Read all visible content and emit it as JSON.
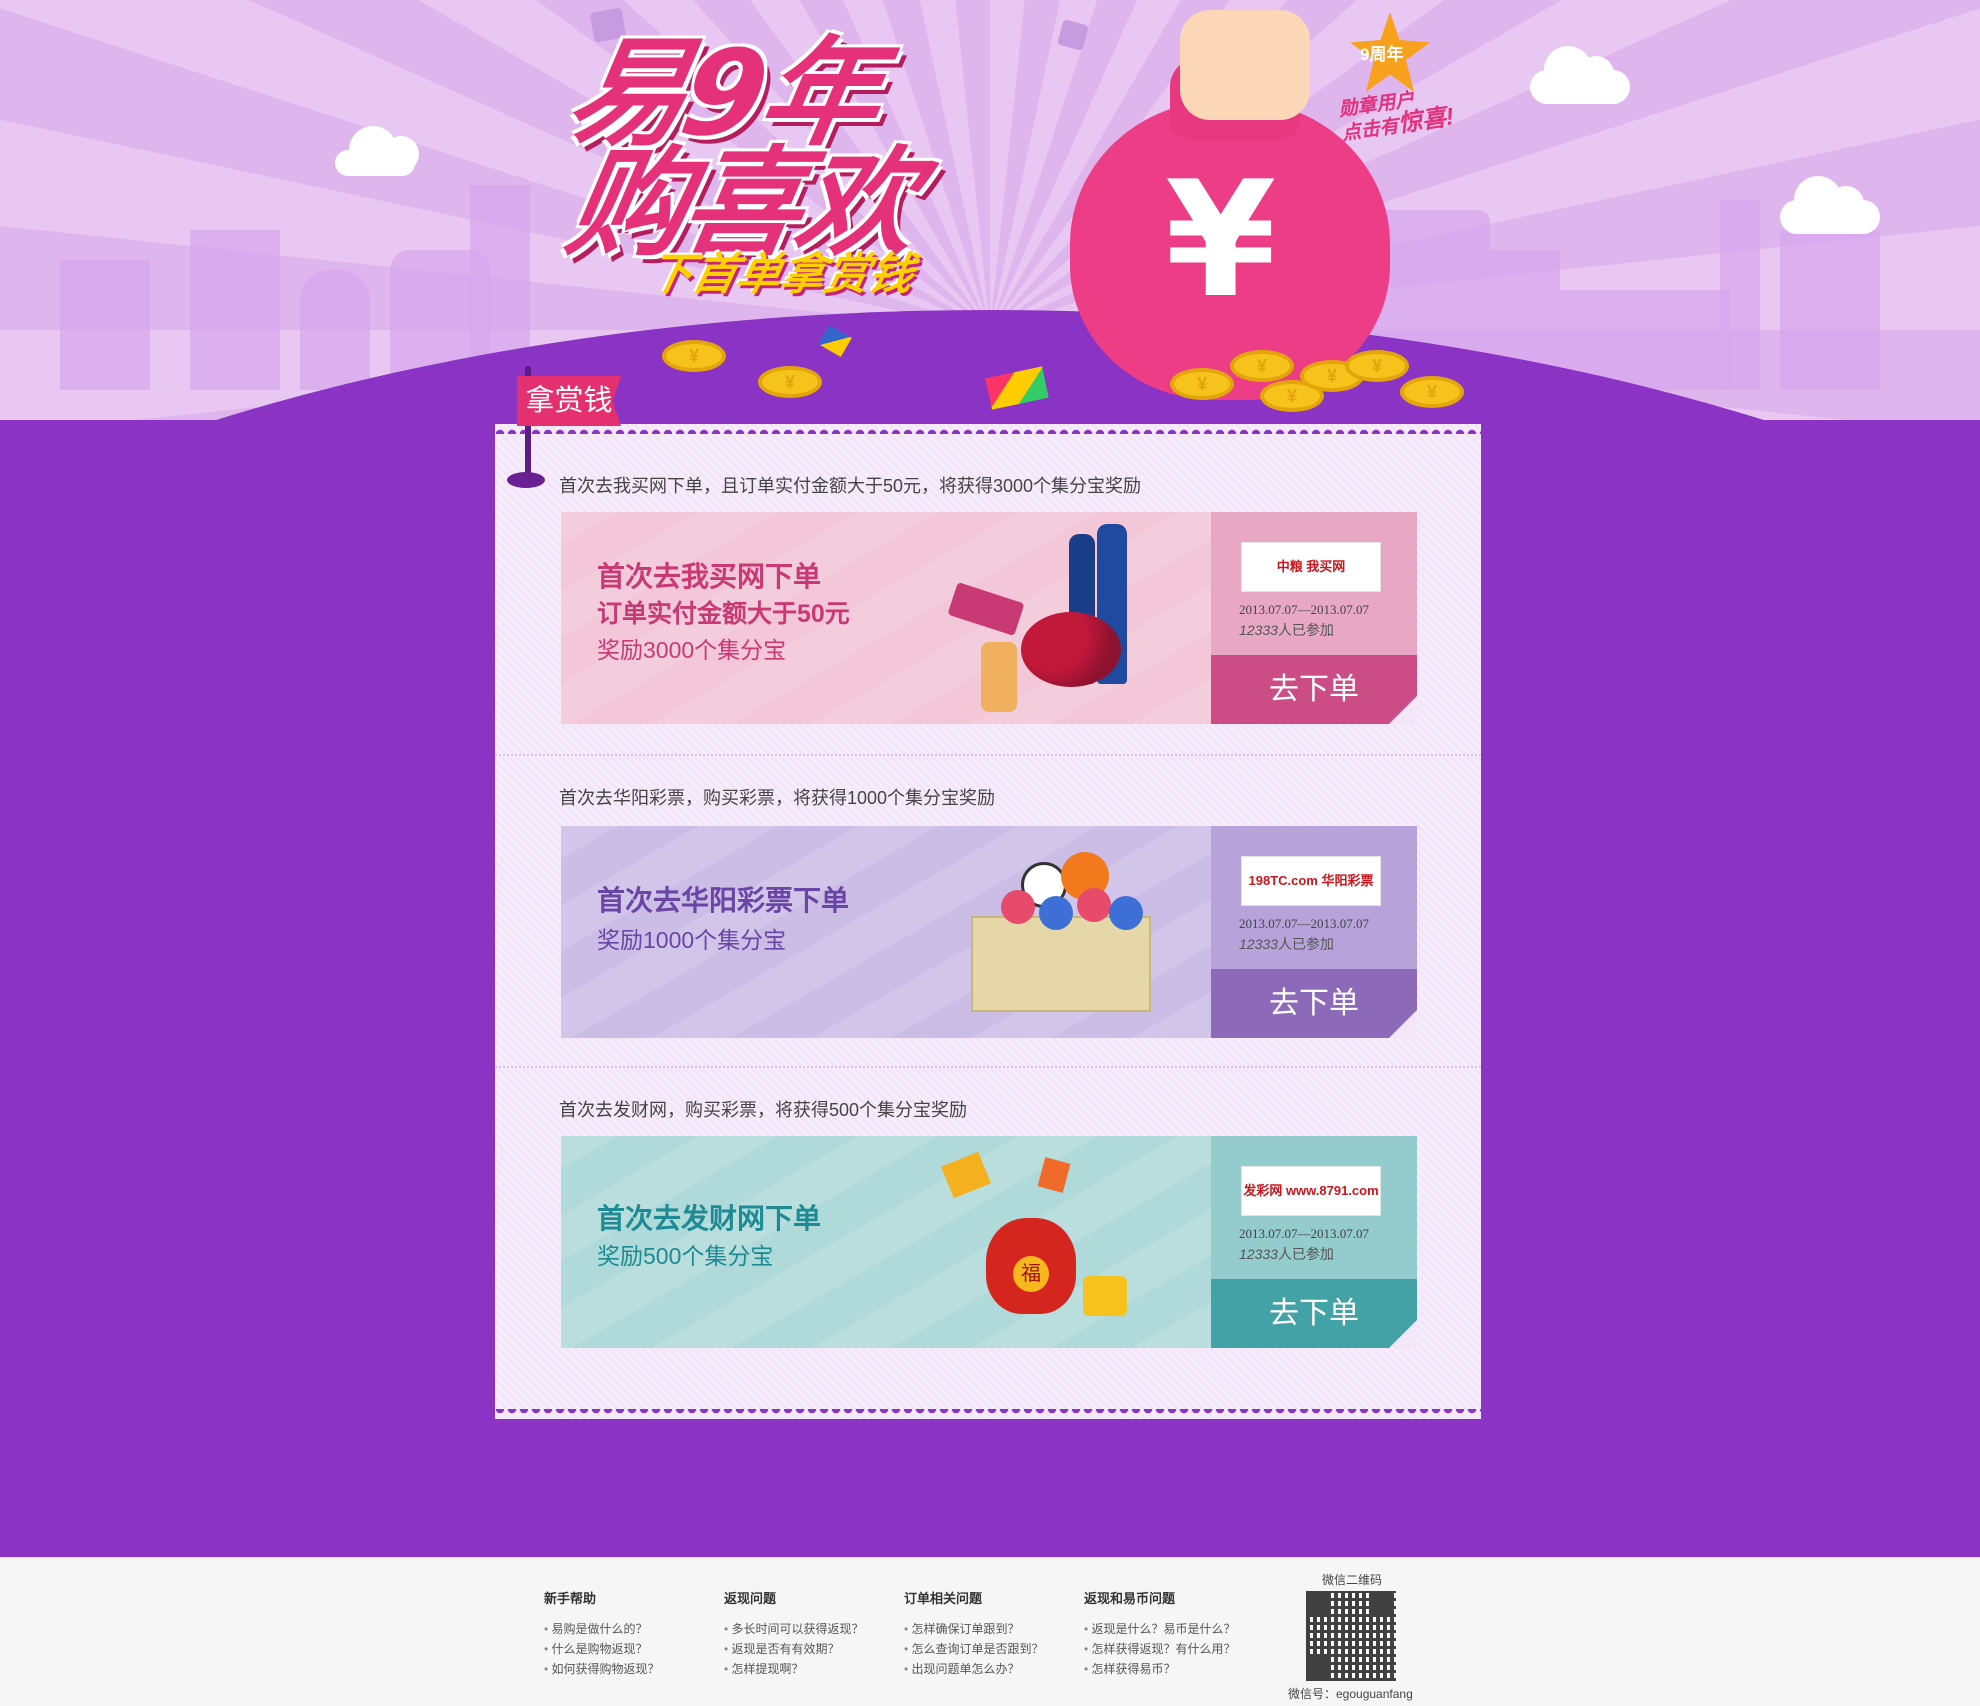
{
  "hero": {
    "title_line1": "易9年",
    "title_line2": "购喜欢",
    "subtitle": "下首单拿赏钱",
    "badge_top": "9周年",
    "badge_line1": "勋章用户",
    "badge_line2": "点击有",
    "badge_emph": "惊喜!"
  },
  "card": {
    "flag": "拿赏钱",
    "sections": [
      {
        "title": "首次去我买网下单，且订单实付金额大于50元，将获得3000个集分宝奖励",
        "heading": "首次去我买网下单",
        "line2": "订单实付金额大于50元",
        "line3": "奖励3000个集分宝",
        "logo": "中粮 我买网",
        "date": "2013.07.07—2013.07.07",
        "count": "12333",
        "count_suffix": "人已参加",
        "button": "去下单",
        "accent": "#cc4d86"
      },
      {
        "title": "首次去华阳彩票，购买彩票，将获得1000个集分宝奖励",
        "heading": "首次去华阳彩票下单",
        "line2": "奖励1000个集分宝",
        "logo": "198TC.com 华阳彩票",
        "date": "2013.07.07—2013.07.07",
        "count": "12333",
        "count_suffix": "人已参加",
        "button": "去下单",
        "accent": "#8c6ab9"
      },
      {
        "title": "首次去发财网，购买彩票，将获得500个集分宝奖励",
        "heading": "首次去发财网下单",
        "line2": "奖励500个集分宝",
        "logo": "发彩网 www.8791.com",
        "date": "2013.07.07—2013.07.07",
        "count": "12333",
        "count_suffix": "人已参加",
        "button": "去下单",
        "accent": "#43a2a6"
      }
    ]
  },
  "footer": {
    "columns": [
      {
        "head": "新手帮助",
        "links": [
          "易购是做什么的？",
          "什么是购物返现？",
          "如何获得购物返现？"
        ]
      },
      {
        "head": "返现问题",
        "links": [
          "多长时间可以获得返现？",
          "返现是否有有效期？",
          "怎样提现啊？"
        ]
      },
      {
        "head": "订单相关问题",
        "links": [
          "怎样确保订单跟到？",
          "怎么查询订单是否跟到？",
          "出现问题单怎么办？"
        ]
      },
      {
        "head": "返现和易币问题",
        "links": [
          "返现是什么？易币是什么？",
          "怎样获得返现？有什么用？",
          "怎样获得易币？"
        ]
      }
    ],
    "qr_title": "微信二维码",
    "qr_caption": "微信号：egouguanfang"
  },
  "colors": {
    "background": "#8a33c4",
    "pink": "#cc4d86",
    "purple": "#8c6ab9",
    "teal": "#43a2a6"
  }
}
